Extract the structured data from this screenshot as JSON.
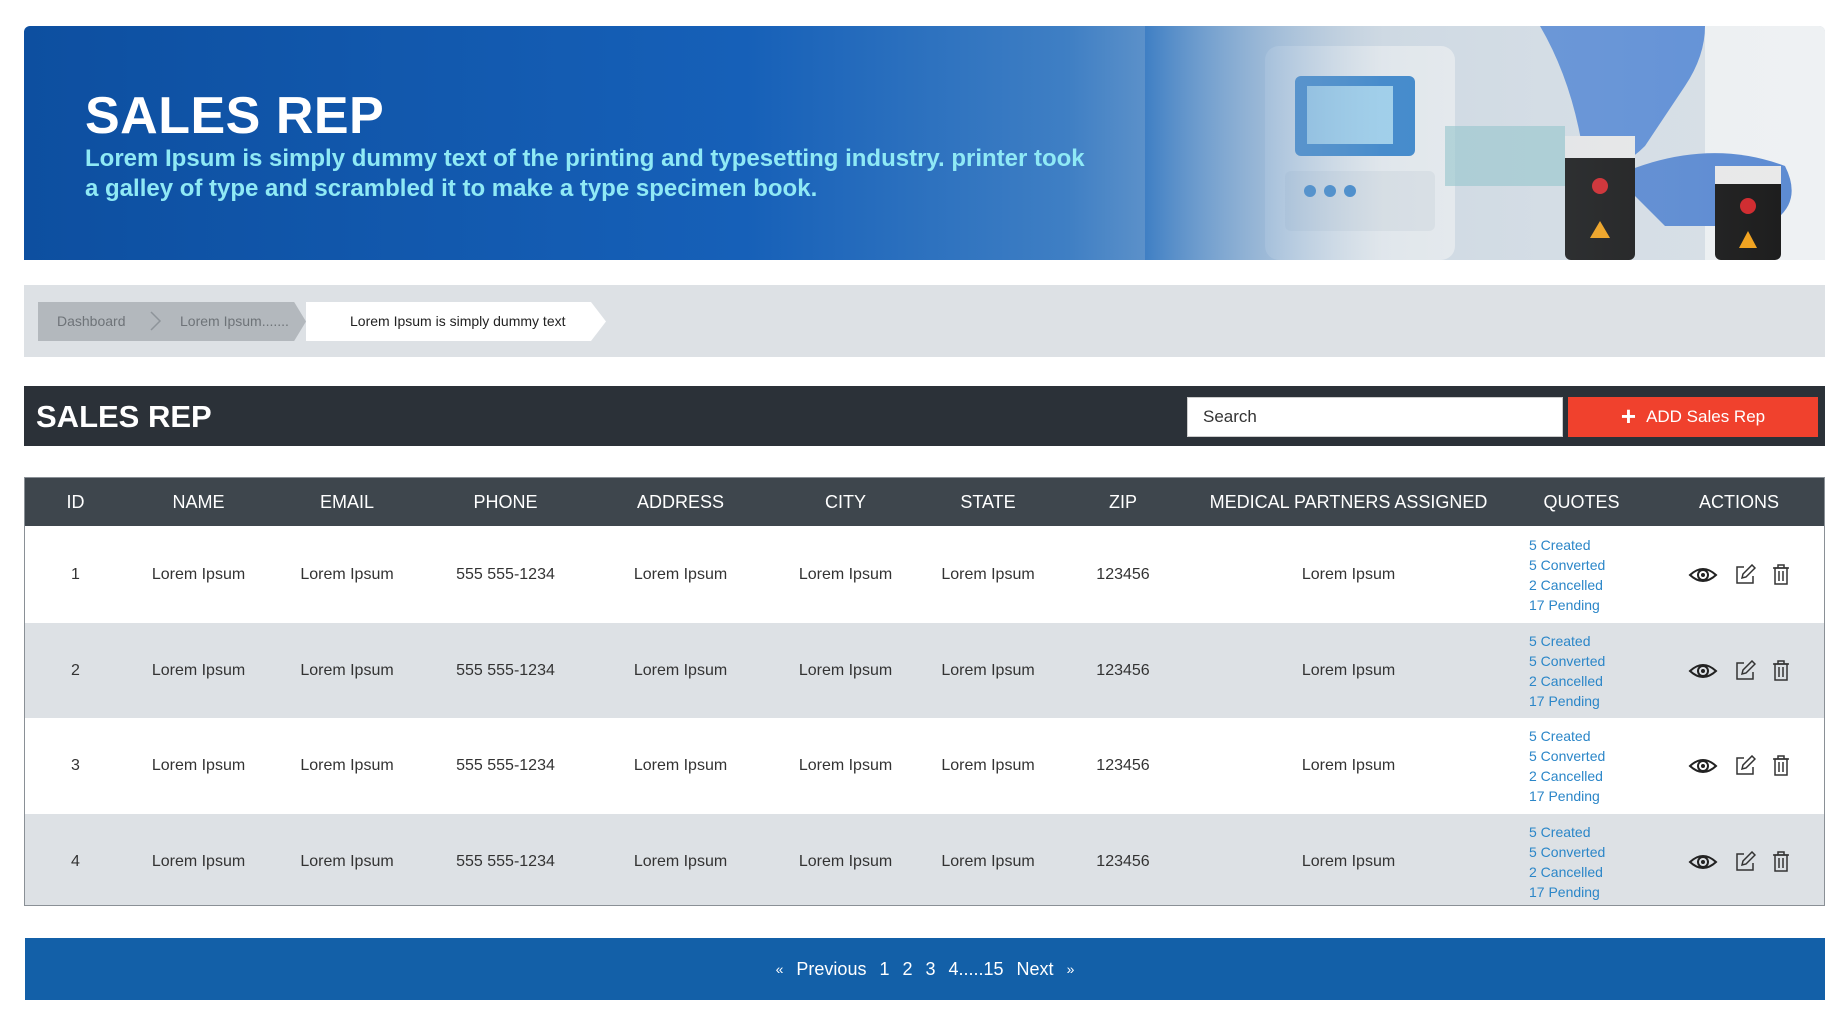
{
  "hero": {
    "title": "SALES REP",
    "subtitle": "Lorem Ipsum is simply dummy text of the printing and typesetting industry. printer took a galley of type and scrambled it to make a type specimen book."
  },
  "breadcrumb": [
    "Dashboard",
    "Lorem Ipsum.......",
    "Lorem Ipsum is simply dummy text"
  ],
  "section": {
    "title": "SALES REP",
    "search_placeholder": "Search",
    "add_plus": "+",
    "add_label": "ADD  Sales Rep"
  },
  "table": {
    "headers": [
      "ID",
      "NAME",
      "EMAIL",
      "PHONE",
      "ADDRESS",
      "CITY",
      "STATE",
      "ZIP",
      "MEDICAL PARTNERS ASSIGNED",
      "QUOTES",
      "ACTIONS"
    ],
    "rows": [
      {
        "id": "1",
        "name": "Lorem Ipsum",
        "email": "Lorem Ipsum",
        "phone": "555 555-1234",
        "address": "Lorem Ipsum",
        "city": "Lorem Ipsum",
        "state": "Lorem Ipsum",
        "zip": "123456",
        "partners": "Lorem Ipsum",
        "quotes": [
          "5 Created",
          "5 Converted",
          "2 Cancelled",
          "17 Pending"
        ]
      },
      {
        "id": "2",
        "name": "Lorem Ipsum",
        "email": "Lorem Ipsum",
        "phone": "555 555-1234",
        "address": "Lorem Ipsum",
        "city": "Lorem Ipsum",
        "state": "Lorem Ipsum",
        "zip": "123456",
        "partners": "Lorem Ipsum",
        "quotes": [
          "5 Created",
          "5 Converted",
          "2 Cancelled",
          "17 Pending"
        ]
      },
      {
        "id": "3",
        "name": "Lorem Ipsum",
        "email": "Lorem Ipsum",
        "phone": "555 555-1234",
        "address": "Lorem Ipsum",
        "city": "Lorem Ipsum",
        "state": "Lorem Ipsum",
        "zip": "123456",
        "partners": "Lorem Ipsum",
        "quotes": [
          "5 Created",
          "5 Converted",
          "2 Cancelled",
          "17 Pending"
        ]
      },
      {
        "id": "4",
        "name": "Lorem Ipsum",
        "email": "Lorem Ipsum",
        "phone": "555 555-1234",
        "address": "Lorem Ipsum",
        "city": "Lorem Ipsum",
        "state": "Lorem Ipsum",
        "zip": "123456",
        "partners": "Lorem Ipsum",
        "quotes": [
          "5 Created",
          "5 Converted",
          "2 Cancelled",
          "17 Pending"
        ]
      }
    ],
    "row_actions": [
      "view-icon",
      "edit-icon",
      "delete-icon"
    ]
  },
  "pagination": {
    "first_icon": "«",
    "previous": "Previous",
    "pages": [
      "1",
      "2",
      "3",
      "4.....15"
    ],
    "next": "Next",
    "last_icon": "»"
  },
  "colors": {
    "hero_blue": "#1660b8",
    "subtitle_cyan": "#8fe9f5",
    "section_dark": "#2b3138",
    "table_header": "#3e464d",
    "row_alt": "#dde1e5",
    "add_button": "#f0412d",
    "link_blue": "#2b86c8",
    "pager_blue": "#1360a8"
  }
}
